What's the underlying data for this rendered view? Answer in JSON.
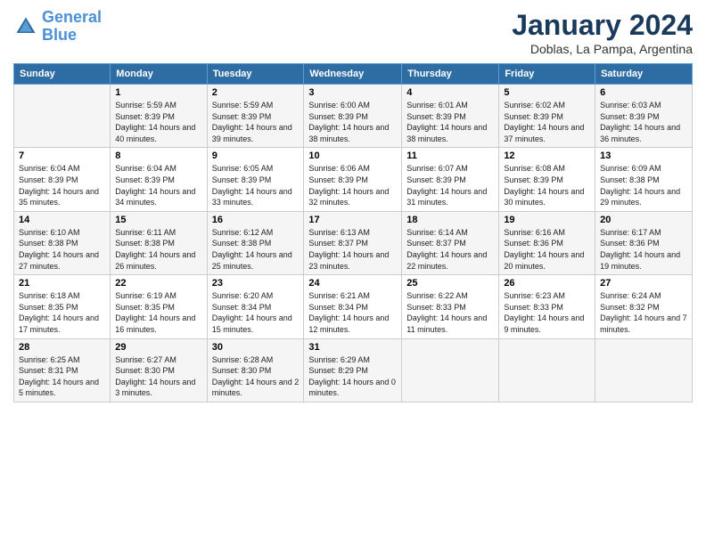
{
  "logo": {
    "line1": "General",
    "line2": "Blue"
  },
  "title": "January 2024",
  "subtitle": "Doblas, La Pampa, Argentina",
  "days_of_week": [
    "Sunday",
    "Monday",
    "Tuesday",
    "Wednesday",
    "Thursday",
    "Friday",
    "Saturday"
  ],
  "weeks": [
    [
      {
        "day": "",
        "sunrise": "",
        "sunset": "",
        "daylight": ""
      },
      {
        "day": "1",
        "sunrise": "Sunrise: 5:59 AM",
        "sunset": "Sunset: 8:39 PM",
        "daylight": "Daylight: 14 hours and 40 minutes."
      },
      {
        "day": "2",
        "sunrise": "Sunrise: 5:59 AM",
        "sunset": "Sunset: 8:39 PM",
        "daylight": "Daylight: 14 hours and 39 minutes."
      },
      {
        "day": "3",
        "sunrise": "Sunrise: 6:00 AM",
        "sunset": "Sunset: 8:39 PM",
        "daylight": "Daylight: 14 hours and 38 minutes."
      },
      {
        "day": "4",
        "sunrise": "Sunrise: 6:01 AM",
        "sunset": "Sunset: 8:39 PM",
        "daylight": "Daylight: 14 hours and 38 minutes."
      },
      {
        "day": "5",
        "sunrise": "Sunrise: 6:02 AM",
        "sunset": "Sunset: 8:39 PM",
        "daylight": "Daylight: 14 hours and 37 minutes."
      },
      {
        "day": "6",
        "sunrise": "Sunrise: 6:03 AM",
        "sunset": "Sunset: 8:39 PM",
        "daylight": "Daylight: 14 hours and 36 minutes."
      }
    ],
    [
      {
        "day": "7",
        "sunrise": "Sunrise: 6:04 AM",
        "sunset": "Sunset: 8:39 PM",
        "daylight": "Daylight: 14 hours and 35 minutes."
      },
      {
        "day": "8",
        "sunrise": "Sunrise: 6:04 AM",
        "sunset": "Sunset: 8:39 PM",
        "daylight": "Daylight: 14 hours and 34 minutes."
      },
      {
        "day": "9",
        "sunrise": "Sunrise: 6:05 AM",
        "sunset": "Sunset: 8:39 PM",
        "daylight": "Daylight: 14 hours and 33 minutes."
      },
      {
        "day": "10",
        "sunrise": "Sunrise: 6:06 AM",
        "sunset": "Sunset: 8:39 PM",
        "daylight": "Daylight: 14 hours and 32 minutes."
      },
      {
        "day": "11",
        "sunrise": "Sunrise: 6:07 AM",
        "sunset": "Sunset: 8:39 PM",
        "daylight": "Daylight: 14 hours and 31 minutes."
      },
      {
        "day": "12",
        "sunrise": "Sunrise: 6:08 AM",
        "sunset": "Sunset: 8:39 PM",
        "daylight": "Daylight: 14 hours and 30 minutes."
      },
      {
        "day": "13",
        "sunrise": "Sunrise: 6:09 AM",
        "sunset": "Sunset: 8:38 PM",
        "daylight": "Daylight: 14 hours and 29 minutes."
      }
    ],
    [
      {
        "day": "14",
        "sunrise": "Sunrise: 6:10 AM",
        "sunset": "Sunset: 8:38 PM",
        "daylight": "Daylight: 14 hours and 27 minutes."
      },
      {
        "day": "15",
        "sunrise": "Sunrise: 6:11 AM",
        "sunset": "Sunset: 8:38 PM",
        "daylight": "Daylight: 14 hours and 26 minutes."
      },
      {
        "day": "16",
        "sunrise": "Sunrise: 6:12 AM",
        "sunset": "Sunset: 8:38 PM",
        "daylight": "Daylight: 14 hours and 25 minutes."
      },
      {
        "day": "17",
        "sunrise": "Sunrise: 6:13 AM",
        "sunset": "Sunset: 8:37 PM",
        "daylight": "Daylight: 14 hours and 23 minutes."
      },
      {
        "day": "18",
        "sunrise": "Sunrise: 6:14 AM",
        "sunset": "Sunset: 8:37 PM",
        "daylight": "Daylight: 14 hours and 22 minutes."
      },
      {
        "day": "19",
        "sunrise": "Sunrise: 6:16 AM",
        "sunset": "Sunset: 8:36 PM",
        "daylight": "Daylight: 14 hours and 20 minutes."
      },
      {
        "day": "20",
        "sunrise": "Sunrise: 6:17 AM",
        "sunset": "Sunset: 8:36 PM",
        "daylight": "Daylight: 14 hours and 19 minutes."
      }
    ],
    [
      {
        "day": "21",
        "sunrise": "Sunrise: 6:18 AM",
        "sunset": "Sunset: 8:35 PM",
        "daylight": "Daylight: 14 hours and 17 minutes."
      },
      {
        "day": "22",
        "sunrise": "Sunrise: 6:19 AM",
        "sunset": "Sunset: 8:35 PM",
        "daylight": "Daylight: 14 hours and 16 minutes."
      },
      {
        "day": "23",
        "sunrise": "Sunrise: 6:20 AM",
        "sunset": "Sunset: 8:34 PM",
        "daylight": "Daylight: 14 hours and 15 minutes."
      },
      {
        "day": "24",
        "sunrise": "Sunrise: 6:21 AM",
        "sunset": "Sunset: 8:34 PM",
        "daylight": "Daylight: 14 hours and 12 minutes."
      },
      {
        "day": "25",
        "sunrise": "Sunrise: 6:22 AM",
        "sunset": "Sunset: 8:33 PM",
        "daylight": "Daylight: 14 hours and 11 minutes."
      },
      {
        "day": "26",
        "sunrise": "Sunrise: 6:23 AM",
        "sunset": "Sunset: 8:33 PM",
        "daylight": "Daylight: 14 hours and 9 minutes."
      },
      {
        "day": "27",
        "sunrise": "Sunrise: 6:24 AM",
        "sunset": "Sunset: 8:32 PM",
        "daylight": "Daylight: 14 hours and 7 minutes."
      }
    ],
    [
      {
        "day": "28",
        "sunrise": "Sunrise: 6:25 AM",
        "sunset": "Sunset: 8:31 PM",
        "daylight": "Daylight: 14 hours and 5 minutes."
      },
      {
        "day": "29",
        "sunrise": "Sunrise: 6:27 AM",
        "sunset": "Sunset: 8:30 PM",
        "daylight": "Daylight: 14 hours and 3 minutes."
      },
      {
        "day": "30",
        "sunrise": "Sunrise: 6:28 AM",
        "sunset": "Sunset: 8:30 PM",
        "daylight": "Daylight: 14 hours and 2 minutes."
      },
      {
        "day": "31",
        "sunrise": "Sunrise: 6:29 AM",
        "sunset": "Sunset: 8:29 PM",
        "daylight": "Daylight: 14 hours and 0 minutes."
      },
      {
        "day": "",
        "sunrise": "",
        "sunset": "",
        "daylight": ""
      },
      {
        "day": "",
        "sunrise": "",
        "sunset": "",
        "daylight": ""
      },
      {
        "day": "",
        "sunrise": "",
        "sunset": "",
        "daylight": ""
      }
    ]
  ]
}
